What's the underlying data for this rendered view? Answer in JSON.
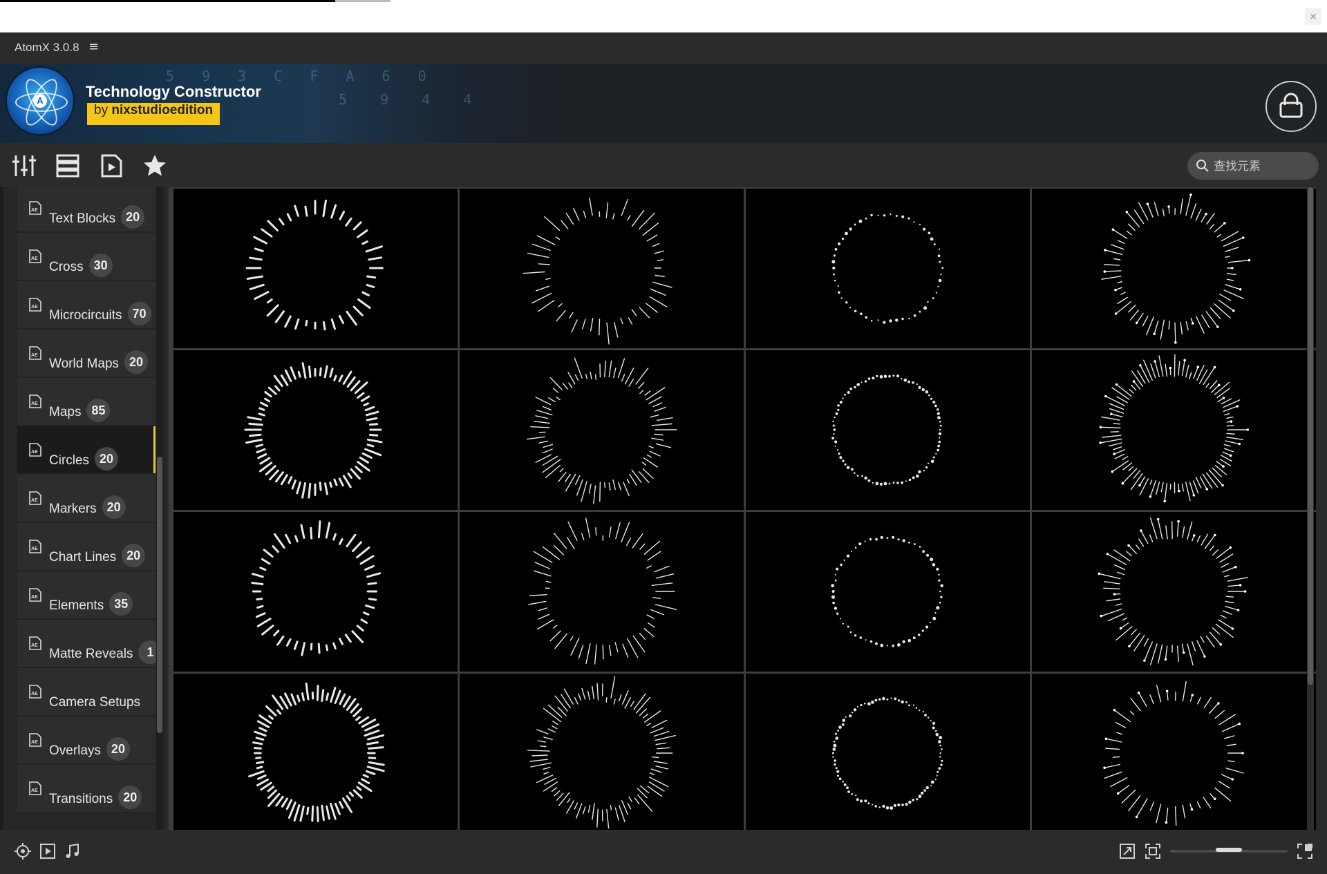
{
  "app": {
    "title": "AtomX 3.0.8",
    "menu_glyph": "≡"
  },
  "banner": {
    "pack_title": "Technology Constructor",
    "author_prefix": "by",
    "author_name": "nixstudioedition",
    "digits_a": "5 9 3 C F A 6 0",
    "digits_b": "5 9 4 4"
  },
  "toolbar": {
    "search_placeholder": "查找元素"
  },
  "sidebar": {
    "items": [
      {
        "label": "Text Blocks",
        "count": "20"
      },
      {
        "label": "Cross",
        "count": "30"
      },
      {
        "label": "Microcircuits",
        "count": "70"
      },
      {
        "label": "World Maps",
        "count": "20"
      },
      {
        "label": "Maps",
        "count": "85"
      },
      {
        "label": "Circles",
        "count": "20",
        "active": true
      },
      {
        "label": "Markers",
        "count": "20"
      },
      {
        "label": "Chart Lines",
        "count": "20"
      },
      {
        "label": "Elements",
        "count": "35"
      },
      {
        "label": "Matte Reveals",
        "count": "1"
      },
      {
        "label": "Camera Setups",
        "count": ""
      },
      {
        "label": "Overlays",
        "count": "20"
      },
      {
        "label": "Transitions",
        "count": "20"
      }
    ]
  },
  "grid": {
    "columns": 4,
    "rows": 4,
    "item_count": 16
  },
  "statusbar": {
    "zoom_fraction": 0.5
  },
  "colors": {
    "accent": "#e2c92e",
    "author_tag": "#f5c518",
    "background": "#2a2a2a",
    "tile_bg": "#000000"
  }
}
